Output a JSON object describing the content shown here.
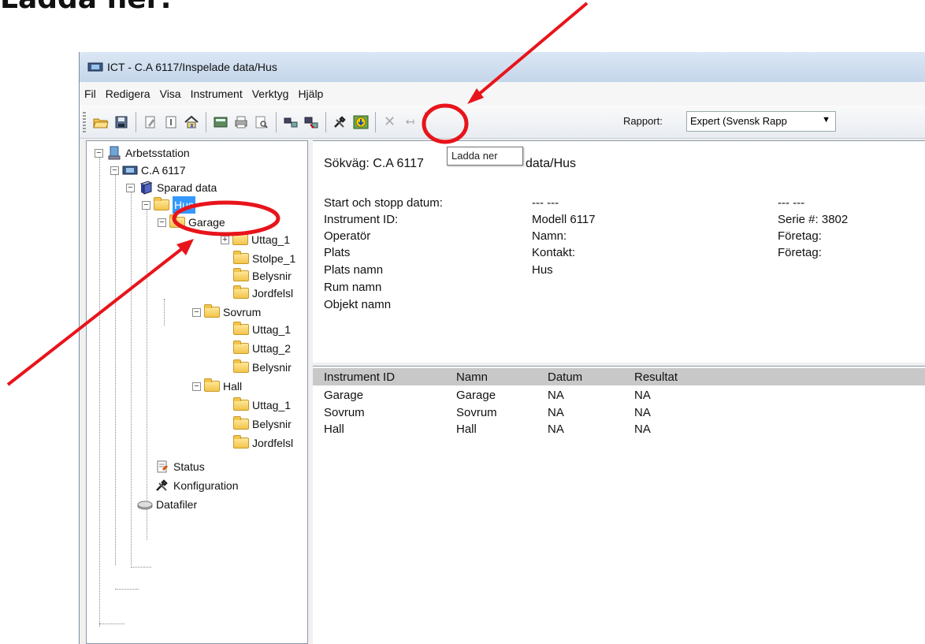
{
  "heading": "Ladda ner:",
  "window": {
    "title": "ICT - C.A 6117/Inspelade data/Hus"
  },
  "menu": [
    "Fil",
    "Redigera",
    "Visa",
    "Instrument",
    "Verktyg",
    "Hjälp"
  ],
  "toolbar": {
    "rapport_label": "Rapport:",
    "rapport_value": "Expert (Svensk Rapp",
    "tooltip": "Ladda ner"
  },
  "tree": [
    {
      "label": "Arbetsstation",
      "icon": "computer-icon"
    },
    {
      "label": "C.A 6117",
      "icon": "instrument-icon"
    },
    {
      "label": "Sparad data",
      "icon": "book-icon"
    },
    {
      "label": "Hus",
      "icon": "folder-icon",
      "selected": true
    },
    {
      "label": "Garage",
      "icon": "folder-icon"
    },
    {
      "label": "Uttag_1",
      "icon": "folder-icon"
    },
    {
      "label": "Stolpe_1",
      "icon": "folder-icon"
    },
    {
      "label": "Belysnir",
      "icon": "folder-icon"
    },
    {
      "label": "Jordfelsl",
      "icon": "folder-icon"
    },
    {
      "label": "Sovrum",
      "icon": "folder-icon"
    },
    {
      "label": "Uttag_1",
      "icon": "folder-icon"
    },
    {
      "label": "Uttag_2",
      "icon": "folder-icon"
    },
    {
      "label": "Belysnir",
      "icon": "folder-icon"
    },
    {
      "label": "Hall",
      "icon": "folder-icon"
    },
    {
      "label": "Uttag_1",
      "icon": "folder-icon"
    },
    {
      "label": "Belysnir",
      "icon": "folder-icon"
    },
    {
      "label": "Jordfelsl",
      "icon": "folder-icon"
    },
    {
      "label": "Status",
      "icon": "status-icon"
    },
    {
      "label": "Konfiguration",
      "icon": "tools-icon"
    },
    {
      "label": "Datafiler",
      "icon": "drive-icon"
    }
  ],
  "info": {
    "path_label": "Sökväg: C.A 6117",
    "path_tail": "data/Hus",
    "rows": [
      {
        "label": "Start och stopp datum:",
        "mid": "--- ---",
        "right": "--- ---"
      },
      {
        "label": "Instrument ID:",
        "mid": "Modell 6117",
        "right": "Serie #: 3802"
      },
      {
        "label": "Operatör",
        "mid": "Namn:",
        "right": "Företag:"
      },
      {
        "label": "Plats",
        "mid": "Kontakt:",
        "right": "Företag:"
      },
      {
        "label": "Plats namn",
        "mid": "Hus",
        "right": ""
      },
      {
        "label": "Rum namn",
        "mid": "",
        "right": ""
      },
      {
        "label": "Objekt namn",
        "mid": "",
        "right": ""
      }
    ]
  },
  "table": {
    "headers": [
      "Instrument ID",
      "Namn",
      "Datum",
      "Resultat"
    ],
    "rows": [
      [
        "Garage",
        "Garage",
        "NA",
        "NA"
      ],
      [
        "Sovrum",
        "Sovrum",
        "NA",
        "NA"
      ],
      [
        "Hall",
        "Hall",
        "NA",
        "NA"
      ]
    ]
  },
  "colors": {
    "annotation": "#e8141b",
    "selection": "#3399ff"
  }
}
